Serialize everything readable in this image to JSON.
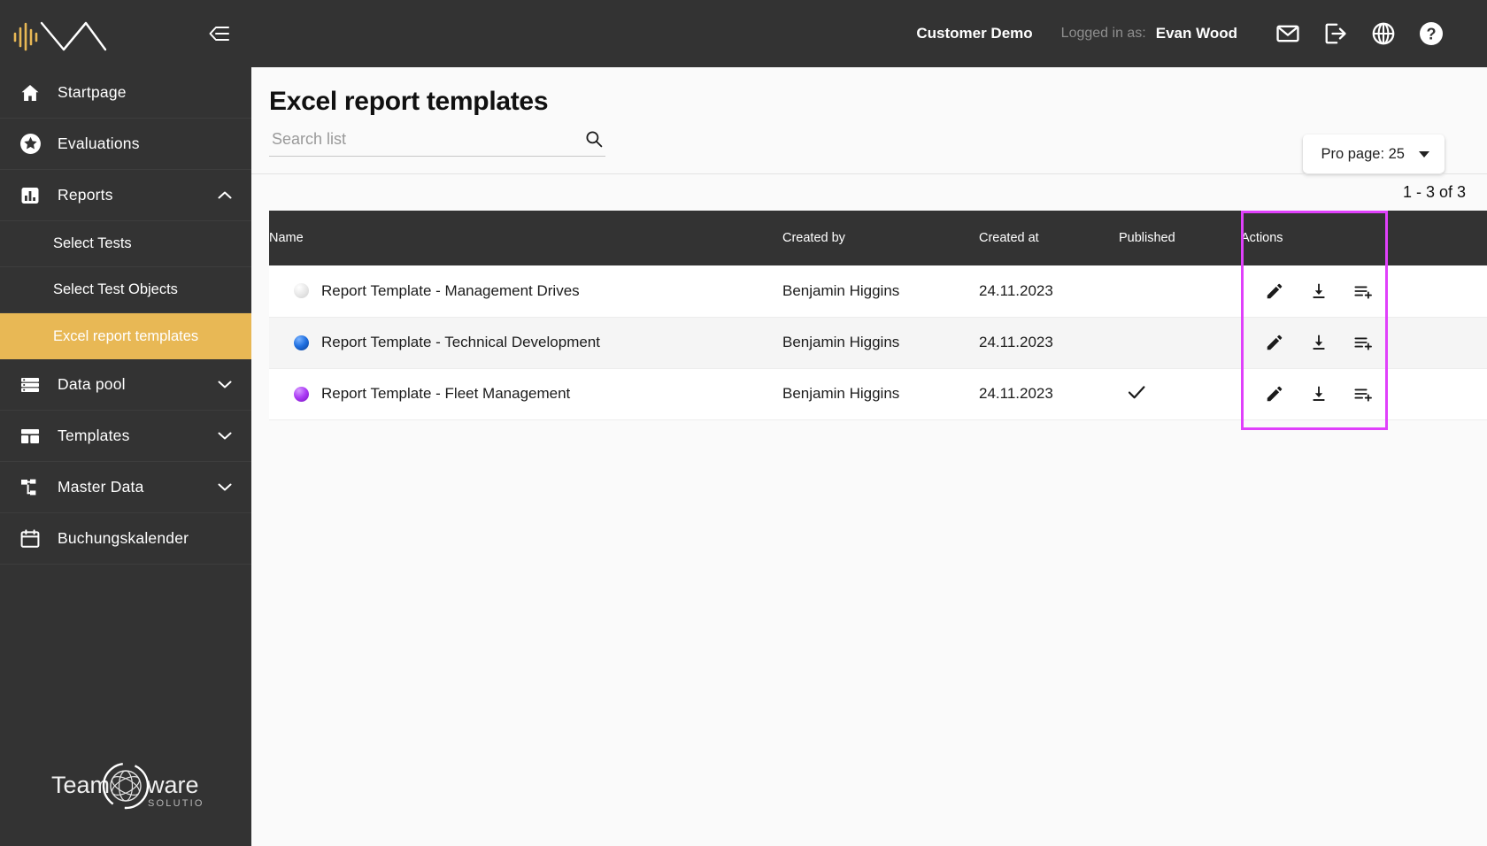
{
  "brand": {
    "logo_name": "company-wave-logo",
    "accent_color": "#e8b855",
    "sidebar_bg": "#333333"
  },
  "sidebar": {
    "collapse_icon": "collapse-panel-icon",
    "items": [
      {
        "label": "Startpage",
        "icon": "home-icon",
        "type": "item",
        "expandable": false
      },
      {
        "label": "Evaluations",
        "icon": "star-badge-icon",
        "type": "item",
        "expandable": false
      },
      {
        "label": "Reports",
        "icon": "bar-chart-icon",
        "type": "item",
        "expandable": true,
        "expanded": true
      },
      {
        "label": "Select Tests",
        "type": "sub",
        "active": false
      },
      {
        "label": "Select Test Objects",
        "type": "sub",
        "active": false
      },
      {
        "label": "Excel report templates",
        "type": "sub",
        "active": true
      },
      {
        "label": "Data pool",
        "icon": "database-list-icon",
        "type": "item",
        "expandable": true,
        "expanded": false
      },
      {
        "label": "Templates",
        "icon": "layout-template-icon",
        "type": "item",
        "expandable": true,
        "expanded": false
      },
      {
        "label": "Master Data",
        "icon": "hierarchy-icon",
        "type": "item",
        "expandable": true,
        "expanded": false
      },
      {
        "label": "Buchungskalender",
        "icon": "calendar-icon",
        "type": "item",
        "expandable": false
      }
    ],
    "footer_logo": {
      "text_left": "Team",
      "text_right": "ware",
      "subtitle": "SOLUTIONS"
    }
  },
  "topbar": {
    "tenant": "Customer Demo",
    "logged_in_label": "Logged in as:",
    "user_name": "Evan Wood",
    "icons": [
      {
        "name": "mail-icon"
      },
      {
        "name": "logout-icon"
      },
      {
        "name": "globe-language-icon"
      },
      {
        "name": "help-circle-icon"
      }
    ]
  },
  "page": {
    "title": "Excel report templates",
    "search": {
      "placeholder": "Search list",
      "value": "",
      "icon": "search-icon"
    },
    "per_page": {
      "label": "Pro page: 25",
      "icon": "chevron-down-icon"
    },
    "result_count": "1 - 3 of 3"
  },
  "table": {
    "columns": [
      {
        "key": "name",
        "label": "Name"
      },
      {
        "key": "created_by",
        "label": "Created by"
      },
      {
        "key": "created_at",
        "label": "Created at"
      },
      {
        "key": "published",
        "label": "Published"
      },
      {
        "key": "actions",
        "label": "Actions"
      }
    ],
    "highlight": {
      "column": "actions",
      "color": "#e040fb"
    },
    "row_actions": [
      {
        "name": "edit-icon",
        "title": "Edit"
      },
      {
        "name": "download-icon",
        "title": "Download"
      },
      {
        "name": "add-to-list-icon",
        "title": "Add to list"
      }
    ],
    "rows": [
      {
        "dot_color": "#e0e0e0",
        "name": "Report Template - Management Drives",
        "created_by": "Benjamin Higgins",
        "created_at": "24.11.2023",
        "published": false
      },
      {
        "dot_color": "#1565d8",
        "name": "Report Template - Technical Development",
        "created_by": "Benjamin Higgins",
        "created_at": "24.11.2023",
        "published": false
      },
      {
        "dot_color": "#a12ef0",
        "name": "Report Template - Fleet Management",
        "created_by": "Benjamin Higgins",
        "created_at": "24.11.2023",
        "published": true
      }
    ]
  }
}
